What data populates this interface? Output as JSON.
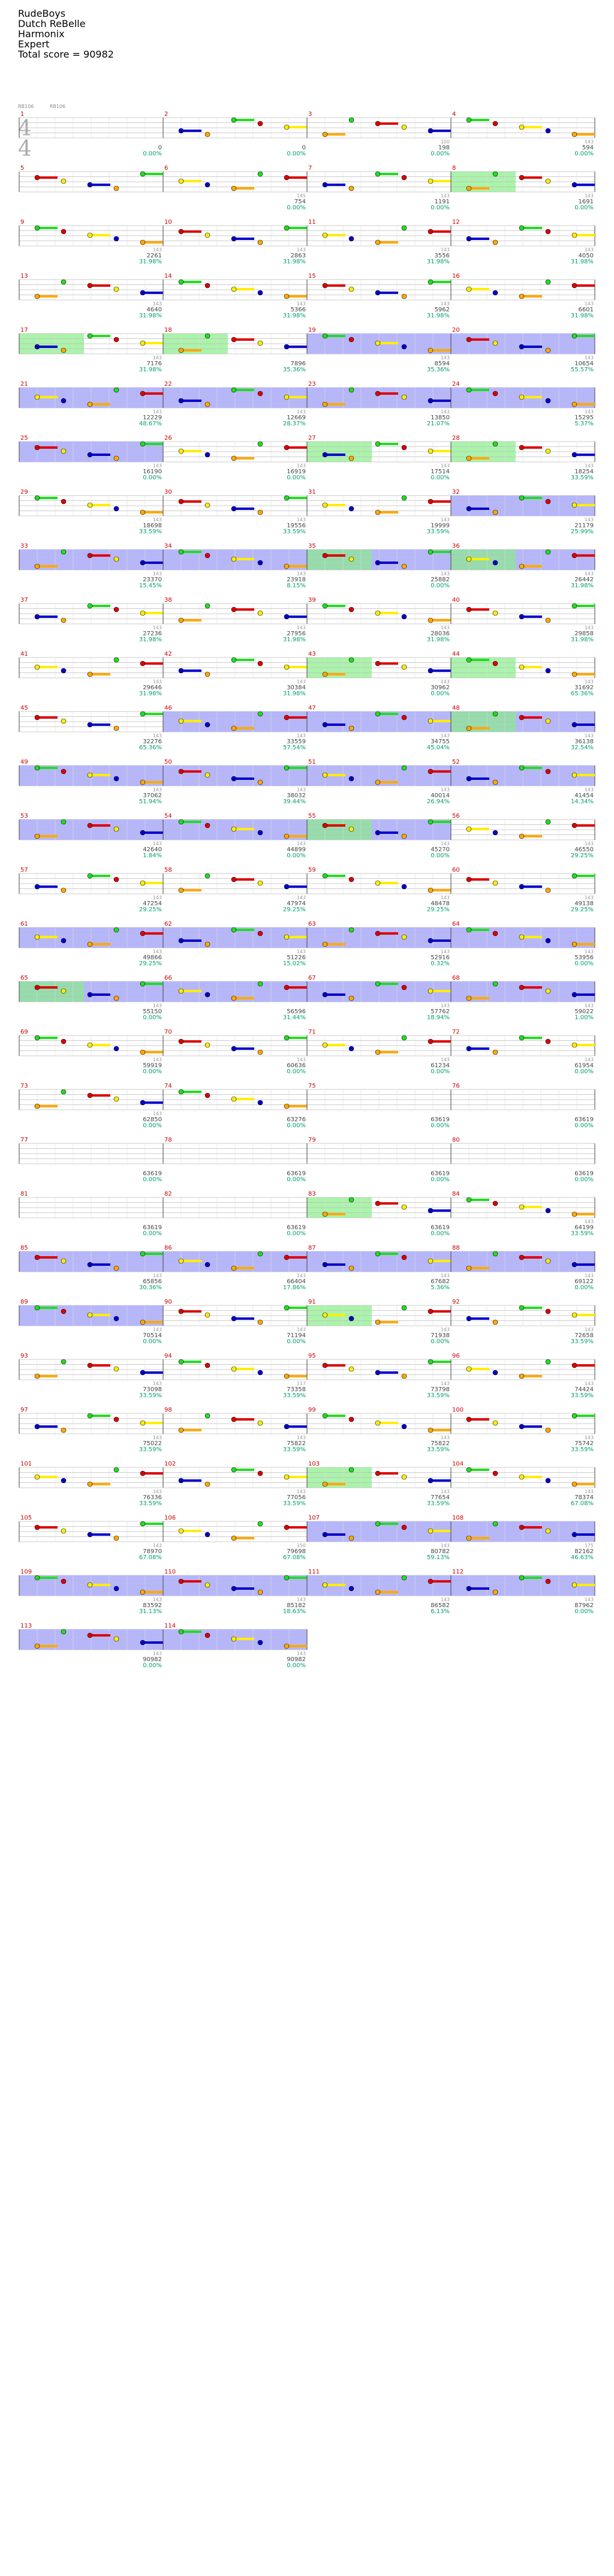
{
  "header": {
    "artist": "RudeBoys",
    "song": "Dutch ReBelle",
    "game": "Harmonix",
    "difficulty": "Expert",
    "total_label": "Total score = 90982"
  },
  "meta": {
    "tag1": "RB106",
    "tag2": "RB106",
    "time_sig": [
      "4",
      "4"
    ]
  },
  "colors": {
    "green": "#22dd22",
    "red": "#dd0000",
    "yellow": "#ffee00",
    "blue": "#0000cc",
    "orange": "#ffaa00",
    "purple": "#990099",
    "overdrive": "#7a7aff",
    "solo": "#88ee88"
  },
  "measures": [
    {
      "n": 1,
      "score": "0",
      "pct": "0.00%",
      "count": ""
    },
    {
      "n": 2,
      "score": "0",
      "pct": "0.00%",
      "count": ""
    },
    {
      "n": 3,
      "score": "198",
      "pct": "0.00%",
      "count": "100"
    },
    {
      "n": 4,
      "score": "594",
      "pct": "0.00%",
      "count": "143"
    },
    {
      "n": 5,
      "score": "",
      "pct": "",
      "count": ""
    },
    {
      "n": 6,
      "score": "754",
      "pct": "0.00%",
      "count": "145"
    },
    {
      "n": 7,
      "score": "1191",
      "pct": "0.00%",
      "count": "143"
    },
    {
      "n": 8,
      "score": "1691",
      "pct": "0.00%",
      "count": "143"
    },
    {
      "n": 9,
      "score": "2261",
      "pct": "31.98%",
      "count": "143"
    },
    {
      "n": 10,
      "score": "2863",
      "pct": "31.98%",
      "count": "143"
    },
    {
      "n": 11,
      "score": "3556",
      "pct": "31.98%",
      "count": "143"
    },
    {
      "n": 12,
      "score": "4050",
      "pct": "31.98%",
      "count": "143"
    },
    {
      "n": 13,
      "score": "4640",
      "pct": "31.98%",
      "count": "143"
    },
    {
      "n": 14,
      "score": "5366",
      "pct": "31.98%",
      "count": "143"
    },
    {
      "n": 15,
      "score": "5962",
      "pct": "31.98%",
      "count": "143"
    },
    {
      "n": 16,
      "score": "6601",
      "pct": "31.98%",
      "count": "143"
    },
    {
      "n": 17,
      "score": "7176",
      "pct": "31.98%",
      "count": "143"
    },
    {
      "n": 18,
      "score": "7896",
      "pct": "35.36%",
      "count": ""
    },
    {
      "n": 19,
      "score": "8594",
      "pct": "35.36%",
      "count": "143"
    },
    {
      "n": 20,
      "score": "10654",
      "pct": "55.57%",
      "count": "143"
    },
    {
      "n": 21,
      "score": "12229",
      "pct": "48.67%",
      "count": "143"
    },
    {
      "n": 22,
      "score": "12669",
      "pct": "28.37%",
      "count": "143"
    },
    {
      "n": 23,
      "score": "13850",
      "pct": "21.07%",
      "count": "143"
    },
    {
      "n": 24,
      "score": "15295",
      "pct": "5.37%",
      "count": "143"
    },
    {
      "n": 25,
      "score": "16190",
      "pct": "0.00%",
      "count": "143"
    },
    {
      "n": 26,
      "score": "16919",
      "pct": "0.00%",
      "count": "143"
    },
    {
      "n": 27,
      "score": "17514",
      "pct": "0.00%",
      "count": "143"
    },
    {
      "n": 28,
      "score": "18254",
      "pct": "33.59%",
      "count": "143"
    },
    {
      "n": 29,
      "score": "18698",
      "pct": "33.59%",
      "count": "143"
    },
    {
      "n": 30,
      "score": "19556",
      "pct": "33.59%",
      "count": "143"
    },
    {
      "n": 31,
      "score": "19999",
      "pct": "33.59%",
      "count": "143"
    },
    {
      "n": 32,
      "score": "21179",
      "pct": "25.99%",
      "count": "143"
    },
    {
      "n": 33,
      "score": "23370",
      "pct": "15.45%",
      "count": "143"
    },
    {
      "n": 34,
      "score": "23918",
      "pct": "8.15%",
      "count": "143"
    },
    {
      "n": 35,
      "score": "25882",
      "pct": "0.00%",
      "count": "143"
    },
    {
      "n": 36,
      "score": "26442",
      "pct": "31.98%",
      "count": "143"
    },
    {
      "n": 37,
      "score": "27236",
      "pct": "31.98%",
      "count": "143"
    },
    {
      "n": 38,
      "score": "27956",
      "pct": "31.98%",
      "count": "143"
    },
    {
      "n": 39,
      "score": "28036",
      "pct": "31.98%",
      "count": "143"
    },
    {
      "n": 40,
      "score": "29858",
      "pct": "31.98%",
      "count": "143"
    },
    {
      "n": 41,
      "score": "29646",
      "pct": "31.98%",
      "count": "143"
    },
    {
      "n": 42,
      "score": "30384",
      "pct": "31.98%",
      "count": "143"
    },
    {
      "n": 43,
      "score": "30962",
      "pct": "0.00%",
      "count": "143"
    },
    {
      "n": 44,
      "score": "31692",
      "pct": "65.36%",
      "count": "143"
    },
    {
      "n": 45,
      "score": "32276",
      "pct": "65.36%",
      "count": "143"
    },
    {
      "n": 46,
      "score": "33559",
      "pct": "57.54%",
      "count": "143"
    },
    {
      "n": 47,
      "score": "34755",
      "pct": "45.04%",
      "count": "143"
    },
    {
      "n": 48,
      "score": "36138",
      "pct": "32.54%",
      "count": "143"
    },
    {
      "n": 49,
      "score": "37062",
      "pct": "51.94%",
      "count": "143"
    },
    {
      "n": 50,
      "score": "38032",
      "pct": "39.44%",
      "count": "143"
    },
    {
      "n": 51,
      "score": "40014",
      "pct": "26.94%",
      "count": "143"
    },
    {
      "n": 52,
      "score": "41454",
      "pct": "14.34%",
      "count": "143"
    },
    {
      "n": 53,
      "score": "42640",
      "pct": "1.84%",
      "count": "143"
    },
    {
      "n": 54,
      "score": "44899",
      "pct": "0.00%",
      "count": "143"
    },
    {
      "n": 55,
      "score": "45270",
      "pct": "0.00%",
      "count": "143"
    },
    {
      "n": 56,
      "score": "46550",
      "pct": "29.25%",
      "count": "143"
    },
    {
      "n": 57,
      "score": "47254",
      "pct": "29.25%",
      "count": "143"
    },
    {
      "n": 58,
      "score": "47974",
      "pct": "29.25%",
      "count": "143"
    },
    {
      "n": 59,
      "score": "48478",
      "pct": "29.25%",
      "count": "143"
    },
    {
      "n": 60,
      "score": "49138",
      "pct": "29.25%",
      "count": "143"
    },
    {
      "n": 61,
      "score": "49866",
      "pct": "29.25%",
      "count": "143"
    },
    {
      "n": 62,
      "score": "51226",
      "pct": "15.02%",
      "count": "143"
    },
    {
      "n": 63,
      "score": "52916",
      "pct": "0.32%",
      "count": "143"
    },
    {
      "n": 64,
      "score": "53956",
      "pct": "0.00%",
      "count": "143"
    },
    {
      "n": 65,
      "score": "55150",
      "pct": "0.00%",
      "count": "143"
    },
    {
      "n": 66,
      "score": "56596",
      "pct": "31.44%",
      "count": ""
    },
    {
      "n": 67,
      "score": "57762",
      "pct": "18.94%",
      "count": "143"
    },
    {
      "n": 68,
      "score": "59022",
      "pct": "1.00%",
      "count": "143"
    },
    {
      "n": 69,
      "score": "59919",
      "pct": "0.00%",
      "count": "143"
    },
    {
      "n": 70,
      "score": "60636",
      "pct": "0.00%",
      "count": "143"
    },
    {
      "n": 71,
      "score": "61234",
      "pct": "0.00%",
      "count": "143"
    },
    {
      "n": 72,
      "score": "61954",
      "pct": "0.00%",
      "count": "143"
    },
    {
      "n": 73,
      "score": "62850",
      "pct": "0.00%",
      "count": "143"
    },
    {
      "n": 74,
      "score": "63276",
      "pct": "0.00%",
      "count": ""
    },
    {
      "n": 75,
      "score": "63619",
      "pct": "0.00%",
      "count": ""
    },
    {
      "n": 76,
      "score": "63619",
      "pct": "0.00%",
      "count": ""
    },
    {
      "n": 77,
      "score": "63619",
      "pct": "0.00%",
      "count": ""
    },
    {
      "n": 78,
      "score": "63619",
      "pct": "0.00%",
      "count": ""
    },
    {
      "n": 79,
      "score": "63619",
      "pct": "0.00%",
      "count": ""
    },
    {
      "n": 80,
      "score": "63619",
      "pct": "0.00%",
      "count": ""
    },
    {
      "n": 81,
      "score": "63619",
      "pct": "0.00%",
      "count": ""
    },
    {
      "n": 82,
      "score": "63619",
      "pct": "0.00%",
      "count": ""
    },
    {
      "n": 83,
      "score": "63619",
      "pct": "0.00%",
      "count": ""
    },
    {
      "n": 84,
      "score": "64199",
      "pct": "33.59%",
      "count": "143"
    },
    {
      "n": 85,
      "score": "65856",
      "pct": "30.36%",
      "count": "143"
    },
    {
      "n": 86,
      "score": "66404",
      "pct": "17.86%",
      "count": "143"
    },
    {
      "n": 87,
      "score": "67682",
      "pct": "5.36%",
      "count": "143"
    },
    {
      "n": 88,
      "score": "69122",
      "pct": "0.00%",
      "count": "143"
    },
    {
      "n": 89,
      "score": "70514",
      "pct": "0.00%",
      "count": "143"
    },
    {
      "n": 90,
      "score": "71194",
      "pct": "0.00%",
      "count": "143"
    },
    {
      "n": 91,
      "score": "71938",
      "pct": "0.00%",
      "count": "143"
    },
    {
      "n": 92,
      "score": "72658",
      "pct": "33.59%",
      "count": "143"
    },
    {
      "n": 93,
      "score": "73098",
      "pct": "33.59%",
      "count": "143"
    },
    {
      "n": 94,
      "score": "73358",
      "pct": "33.59%",
      "count": "117"
    },
    {
      "n": 95,
      "score": "73798",
      "pct": "33.59%",
      "count": "143"
    },
    {
      "n": 96,
      "score": "74424",
      "pct": "33.59%",
      "count": "143"
    },
    {
      "n": 97,
      "score": "75022",
      "pct": "33.59%",
      "count": "143"
    },
    {
      "n": 98,
      "score": "75822",
      "pct": "33.59%",
      "count": "143"
    },
    {
      "n": 99,
      "score": "75822",
      "pct": "33.59%",
      "count": "143"
    },
    {
      "n": 100,
      "score": "75742",
      "pct": "33.59%",
      "count": "143"
    },
    {
      "n": 101,
      "score": "76336",
      "pct": "33.59%",
      "count": "143"
    },
    {
      "n": 102,
      "score": "77056",
      "pct": "33.59%",
      "count": "143"
    },
    {
      "n": 103,
      "score": "77654",
      "pct": "33.59%",
      "count": "143"
    },
    {
      "n": 104,
      "score": "78374",
      "pct": "67.08%",
      "count": "143"
    },
    {
      "n": 105,
      "score": "78970",
      "pct": "67.08%",
      "count": "143"
    },
    {
      "n": 106,
      "score": "79698",
      "pct": "67.08%",
      "count": "150"
    },
    {
      "n": 107,
      "score": "80782",
      "pct": "59.13%",
      "count": "143"
    },
    {
      "n": 108,
      "score": "82162",
      "pct": "46.63%",
      "count": "175"
    },
    {
      "n": 109,
      "score": "83592",
      "pct": "31.13%",
      "count": "143"
    },
    {
      "n": 110,
      "score": "85182",
      "pct": "18.63%",
      "count": "143"
    },
    {
      "n": 111,
      "score": "86582",
      "pct": "6.13%",
      "count": "143"
    },
    {
      "n": 112,
      "score": "87962",
      "pct": "0.00%",
      "count": "143"
    },
    {
      "n": 113,
      "score": "90982",
      "pct": "0.00%",
      "count": "143"
    },
    {
      "n": 114,
      "score": "90982",
      "pct": "0.00%",
      "count": "143"
    }
  ]
}
